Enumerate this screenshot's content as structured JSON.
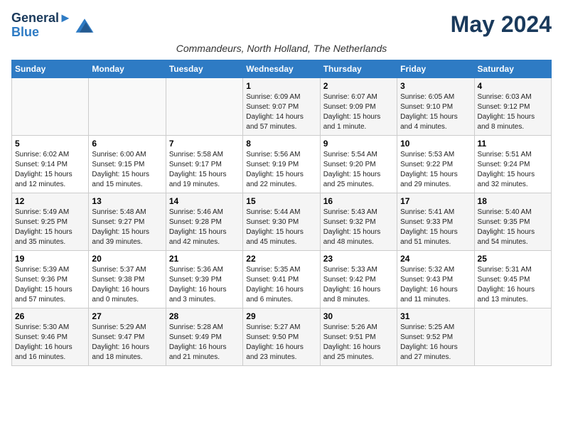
{
  "logo": {
    "line1": "General",
    "line2": "Blue"
  },
  "title": "May 2024",
  "subtitle": "Commandeurs, North Holland, The Netherlands",
  "days_of_week": [
    "Sunday",
    "Monday",
    "Tuesday",
    "Wednesday",
    "Thursday",
    "Friday",
    "Saturday"
  ],
  "weeks": [
    [
      {
        "day": "",
        "info": ""
      },
      {
        "day": "",
        "info": ""
      },
      {
        "day": "",
        "info": ""
      },
      {
        "day": "1",
        "info": "Sunrise: 6:09 AM\nSunset: 9:07 PM\nDaylight: 14 hours\nand 57 minutes."
      },
      {
        "day": "2",
        "info": "Sunrise: 6:07 AM\nSunset: 9:09 PM\nDaylight: 15 hours\nand 1 minute."
      },
      {
        "day": "3",
        "info": "Sunrise: 6:05 AM\nSunset: 9:10 PM\nDaylight: 15 hours\nand 4 minutes."
      },
      {
        "day": "4",
        "info": "Sunrise: 6:03 AM\nSunset: 9:12 PM\nDaylight: 15 hours\nand 8 minutes."
      }
    ],
    [
      {
        "day": "5",
        "info": "Sunrise: 6:02 AM\nSunset: 9:14 PM\nDaylight: 15 hours\nand 12 minutes."
      },
      {
        "day": "6",
        "info": "Sunrise: 6:00 AM\nSunset: 9:15 PM\nDaylight: 15 hours\nand 15 minutes."
      },
      {
        "day": "7",
        "info": "Sunrise: 5:58 AM\nSunset: 9:17 PM\nDaylight: 15 hours\nand 19 minutes."
      },
      {
        "day": "8",
        "info": "Sunrise: 5:56 AM\nSunset: 9:19 PM\nDaylight: 15 hours\nand 22 minutes."
      },
      {
        "day": "9",
        "info": "Sunrise: 5:54 AM\nSunset: 9:20 PM\nDaylight: 15 hours\nand 25 minutes."
      },
      {
        "day": "10",
        "info": "Sunrise: 5:53 AM\nSunset: 9:22 PM\nDaylight: 15 hours\nand 29 minutes."
      },
      {
        "day": "11",
        "info": "Sunrise: 5:51 AM\nSunset: 9:24 PM\nDaylight: 15 hours\nand 32 minutes."
      }
    ],
    [
      {
        "day": "12",
        "info": "Sunrise: 5:49 AM\nSunset: 9:25 PM\nDaylight: 15 hours\nand 35 minutes."
      },
      {
        "day": "13",
        "info": "Sunrise: 5:48 AM\nSunset: 9:27 PM\nDaylight: 15 hours\nand 39 minutes."
      },
      {
        "day": "14",
        "info": "Sunrise: 5:46 AM\nSunset: 9:28 PM\nDaylight: 15 hours\nand 42 minutes."
      },
      {
        "day": "15",
        "info": "Sunrise: 5:44 AM\nSunset: 9:30 PM\nDaylight: 15 hours\nand 45 minutes."
      },
      {
        "day": "16",
        "info": "Sunrise: 5:43 AM\nSunset: 9:32 PM\nDaylight: 15 hours\nand 48 minutes."
      },
      {
        "day": "17",
        "info": "Sunrise: 5:41 AM\nSunset: 9:33 PM\nDaylight: 15 hours\nand 51 minutes."
      },
      {
        "day": "18",
        "info": "Sunrise: 5:40 AM\nSunset: 9:35 PM\nDaylight: 15 hours\nand 54 minutes."
      }
    ],
    [
      {
        "day": "19",
        "info": "Sunrise: 5:39 AM\nSunset: 9:36 PM\nDaylight: 15 hours\nand 57 minutes."
      },
      {
        "day": "20",
        "info": "Sunrise: 5:37 AM\nSunset: 9:38 PM\nDaylight: 16 hours\nand 0 minutes."
      },
      {
        "day": "21",
        "info": "Sunrise: 5:36 AM\nSunset: 9:39 PM\nDaylight: 16 hours\nand 3 minutes."
      },
      {
        "day": "22",
        "info": "Sunrise: 5:35 AM\nSunset: 9:41 PM\nDaylight: 16 hours\nand 6 minutes."
      },
      {
        "day": "23",
        "info": "Sunrise: 5:33 AM\nSunset: 9:42 PM\nDaylight: 16 hours\nand 8 minutes."
      },
      {
        "day": "24",
        "info": "Sunrise: 5:32 AM\nSunset: 9:43 PM\nDaylight: 16 hours\nand 11 minutes."
      },
      {
        "day": "25",
        "info": "Sunrise: 5:31 AM\nSunset: 9:45 PM\nDaylight: 16 hours\nand 13 minutes."
      }
    ],
    [
      {
        "day": "26",
        "info": "Sunrise: 5:30 AM\nSunset: 9:46 PM\nDaylight: 16 hours\nand 16 minutes."
      },
      {
        "day": "27",
        "info": "Sunrise: 5:29 AM\nSunset: 9:47 PM\nDaylight: 16 hours\nand 18 minutes."
      },
      {
        "day": "28",
        "info": "Sunrise: 5:28 AM\nSunset: 9:49 PM\nDaylight: 16 hours\nand 21 minutes."
      },
      {
        "day": "29",
        "info": "Sunrise: 5:27 AM\nSunset: 9:50 PM\nDaylight: 16 hours\nand 23 minutes."
      },
      {
        "day": "30",
        "info": "Sunrise: 5:26 AM\nSunset: 9:51 PM\nDaylight: 16 hours\nand 25 minutes."
      },
      {
        "day": "31",
        "info": "Sunrise: 5:25 AM\nSunset: 9:52 PM\nDaylight: 16 hours\nand 27 minutes."
      },
      {
        "day": "",
        "info": ""
      }
    ]
  ]
}
